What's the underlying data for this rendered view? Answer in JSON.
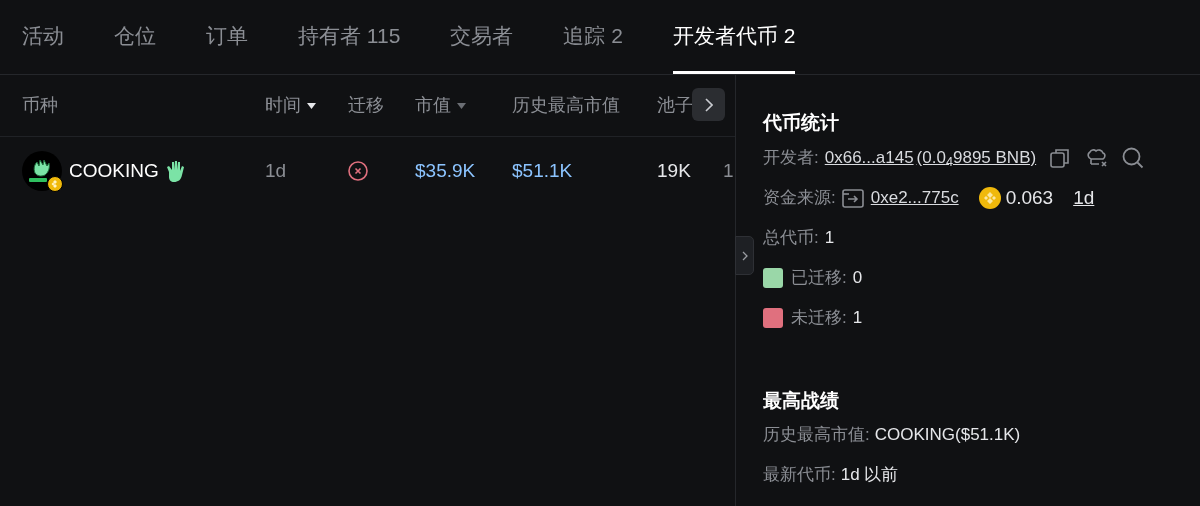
{
  "tabs": [
    {
      "label": "活动",
      "selected": false
    },
    {
      "label": "仓位",
      "selected": false
    },
    {
      "label": "订单",
      "selected": false
    },
    {
      "label": "持有者 115",
      "selected": false
    },
    {
      "label": "交易者",
      "selected": false
    },
    {
      "label": "追踪 2",
      "selected": false
    },
    {
      "label": "开发者代币 2",
      "selected": true
    }
  ],
  "table": {
    "columns": [
      {
        "label": "币种"
      },
      {
        "label": "时间",
        "sort_active": true
      },
      {
        "label": "迁移"
      },
      {
        "label": "市值",
        "sort_active": false
      },
      {
        "label": "历史最高市值"
      },
      {
        "label": "池子"
      }
    ],
    "rows": [
      {
        "token": "COOKING",
        "time": "1d",
        "migrated": false,
        "market_cap": "$35.9K",
        "ath_market_cap": "$51.1K",
        "pool": "19K",
        "column_7": "1"
      }
    ]
  },
  "panel": {
    "stats_title": "代币统计",
    "developer": {
      "label": "开发者:",
      "address": "0x66...a145",
      "balance": "(0.0$_{4}$9895 BNB)"
    },
    "funding": {
      "label": "资金来源:",
      "address": "0xe2...775c",
      "amount": "0.063",
      "age": "1d"
    },
    "total": {
      "label": "总代币:",
      "value": "1"
    },
    "legend": [
      {
        "label": "已迁移:",
        "value": "0",
        "color": "#9ad7a8"
      },
      {
        "label": "未迁移:",
        "value": "1",
        "color": "#e0707e"
      }
    ],
    "best_title": "最高战绩",
    "ath": {
      "label": "历史最高市值:",
      "value": "COOKING($51.1K)"
    },
    "latest": {
      "label": "最新代币:",
      "value": "1d 以前"
    }
  }
}
